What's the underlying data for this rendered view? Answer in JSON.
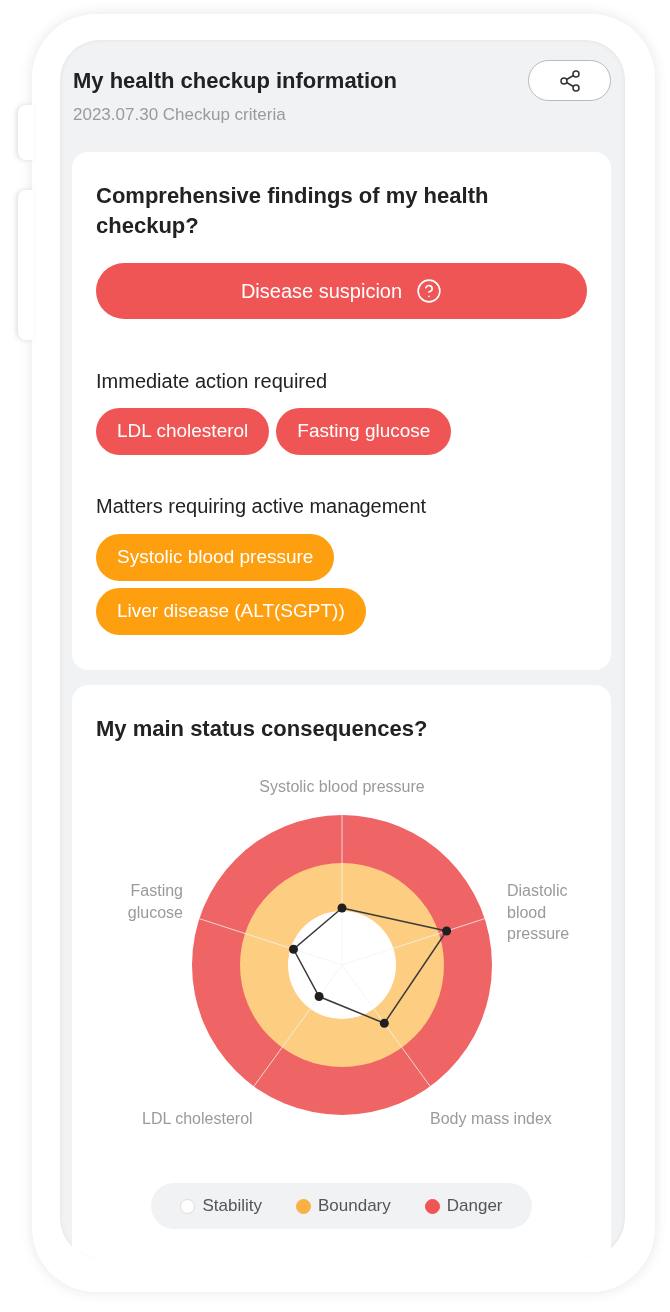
{
  "header": {
    "title": "My health checkup information",
    "subtitle": "2023.07.30 Checkup criteria"
  },
  "findings": {
    "title": "Comprehensive findings of my health checkup?",
    "verdict": {
      "label": "Disease suspicion",
      "kind": "danger"
    },
    "groups": [
      {
        "heading": "Immediate action required",
        "kind": "danger",
        "tags": [
          "LDL cholesterol",
          "Fasting glucose"
        ]
      },
      {
        "heading": "Matters requiring active management",
        "kind": "boundary",
        "tags": [
          "Systolic blood pressure",
          "Liver disease (ALT(SGPT))"
        ]
      }
    ]
  },
  "status": {
    "title": "My main status consequences?",
    "axes": [
      "Systolic blood pressure",
      "Fasting glucose",
      "Diastolic blood pressure",
      "LDL cholesterol",
      "Body mass index"
    ],
    "legend": [
      {
        "label": "Stability",
        "color": "#ffffff"
      },
      {
        "label": "Boundary",
        "color": "#fbb044"
      },
      {
        "label": "Danger",
        "color": "#ef5555"
      }
    ]
  }
}
